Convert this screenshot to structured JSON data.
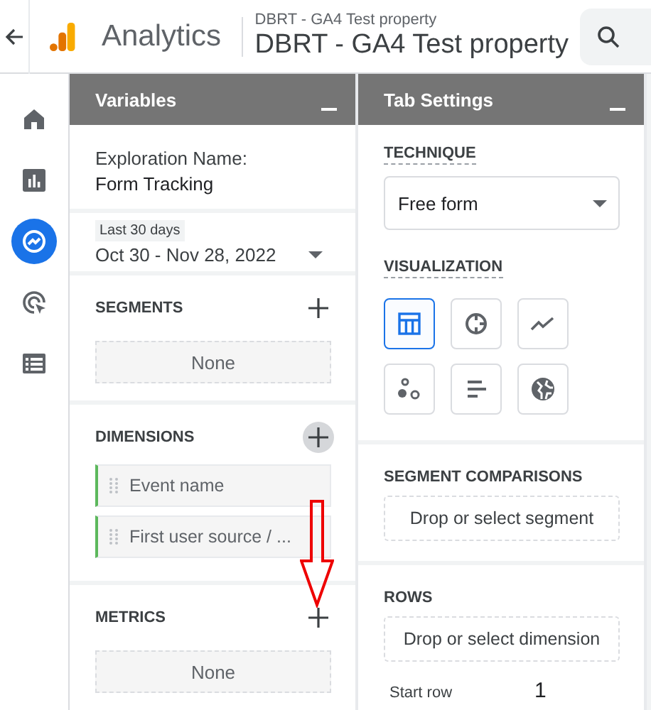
{
  "header": {
    "app_name": "Analytics",
    "property_account": "DBRT - GA4 Test property",
    "property_name": "DBRT - GA4 Test property"
  },
  "nav": [
    {
      "kind": "home",
      "selected": false
    },
    {
      "kind": "reports",
      "selected": false
    },
    {
      "kind": "explore",
      "selected": true
    },
    {
      "kind": "advertising",
      "selected": false
    },
    {
      "kind": "list",
      "selected": false
    }
  ],
  "variables": {
    "title": "Variables",
    "exploration_label": "Exploration Name:",
    "exploration_name": "Form Tracking",
    "date_chip": "Last 30 days",
    "date_range": "Oct 30 - Nov 28, 2022",
    "sections": [
      {
        "label": "SEGMENTS",
        "add_hovered": false,
        "empty": "None"
      },
      {
        "label": "DIMENSIONS",
        "add_hovered": true,
        "items": [
          "Event name",
          "First user source / ..."
        ]
      },
      {
        "label": "METRICS",
        "add_hovered": false,
        "empty": "None"
      }
    ]
  },
  "tab_settings": {
    "title": "Tab Settings",
    "technique_label": "TECHNIQUE",
    "technique": "Free form",
    "visualization_label": "VISUALIZATION",
    "visualizations": [
      {
        "kind": "table",
        "selected": true
      },
      {
        "kind": "donut",
        "selected": false
      },
      {
        "kind": "line",
        "selected": false
      },
      {
        "kind": "scatter",
        "selected": false
      },
      {
        "kind": "bar",
        "selected": false
      },
      {
        "kind": "geo",
        "selected": false
      }
    ],
    "segment_comparisons": {
      "label": "SEGMENT COMPARISONS",
      "drop": "Drop or select segment"
    },
    "rows": {
      "label": "ROWS",
      "drop": "Drop or select dimension",
      "start_row_label": "Start row",
      "start_row": "1"
    }
  }
}
